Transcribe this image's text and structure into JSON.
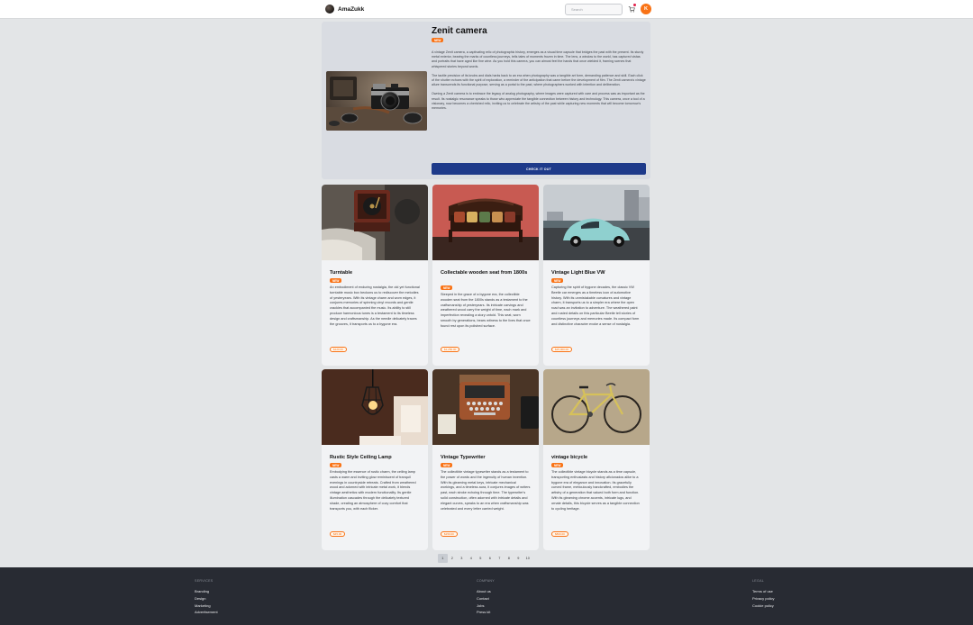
{
  "nav": {
    "brand": "AmaZukk",
    "search_placeholder": "Search",
    "avatar_initial": "K"
  },
  "hero": {
    "title": "Zenit camera",
    "badge": "NEW",
    "paragraphs": [
      "A vintage Zenit camera, a captivating relic of photographic history, emerges as a visual time capsule that bridges the past with the present. Its sturdy metal exterior, bearing the marks of countless journeys, tells tales of moments frozen in time. The lens, a window to the world, has captured vistas and portraits that have aged like fine wine. As you hold this camera, you can almost feel the hands that once wielded it, framing scenes that whispered stories beyond words.",
      "The tactile precision of its knobs and dials harks back to an era when photography was a tangible art form, demanding patience and skill. Each click of the shutter echoes with the spirit of exploration, a reminder of the anticipation that came before the development of film. The Zenit camera's vintage allure transcends its functional purpose, serving as a portal to the past, where photographers worked with intention and deliberation.",
      "Owning a Zenit camera is to embrace the legacy of analog photography, where images were captured with care and process was as important as the result. Its nostalgic resonance speaks to those who appreciate the tangible connection between history and technology. This camera, once a tool of a visionary, now becomes a cherished relic, inviting us to celebrate the artistry of the past while capturing new moments that will become tomorrow's memories."
    ],
    "cta": "CHECK IT OUT"
  },
  "products": [
    {
      "title": "Turntable",
      "badge": "NEW",
      "price": "$120.00",
      "description": "An embodiment of enduring nostalgia, the old yet functional turntable music box beckons us to rediscover the melodies of yesteryears. With its vintage charm and worn edges, it conjures memories of spinning vinyl records and gentle crackles that accompanied the music. Its ability to still produce harmonious tunes is a testament to its timeless design and craftsmanship. As the needle delicately traces the grooves, it transports us to a bygone era."
    },
    {
      "title": "Collectable wooden seat from 1800s",
      "badge": "NEW",
      "price": "$1,250.00",
      "description": "Steeped in the grace of a bygone era, the collectible wooden seat from the 1800s stands as a testament to the craftsmanship of yesteryears. Its intricate carvings and weathered wood carry the weight of time, each mark and imperfection revealing a story untold. This seat, worn smooth by generations, bears witness to the lives that once found rest upon its polished surface."
    },
    {
      "title": "Vintage Light Blue VW",
      "badge": "NEW",
      "price": "$15,000.00",
      "description": "Capturing the spirit of bygone decades, the classic VW Beetle car emerges as a timeless icon of automotive history. With its unmistakable curvatures and vintage charm, it transports us to a simpler era where the open road was an invitation to adventure. The weathered paint and rusted details on this particular Beetle tell stories of countless journeys and memories made. Its compact form and distinctive character evoke a sense of nostalgia."
    },
    {
      "title": "Rustic Style Ceiling Lamp",
      "badge": "NEW",
      "price": "$45.00",
      "description": "Embodying the essence of rustic charm, the ceiling lamp casts a warm and inviting glow reminiscent of tranquil evenings in countryside retreats. Crafted from weathered wood and adorned with intricate metal work, it blends vintage aesthetics with modern functionality. Its gentle illumination cascades through the delicately textured shade, creating an atmosphere of cozy comfort that transports you, with each flicker."
    },
    {
      "title": "Vintage Typewriter",
      "badge": "NEW",
      "price": "$150.00",
      "description": "The collectible vintage typewriter stands as a testament to the power of words and the ingenuity of human invention. With its gleaming metal keys, intricate mechanical workings, and a timeless aura, it conjures images of writers past, each stroke echoing through time. The typewriter's solid construction, often adorned with intricate details and elegant curves, speaks to an era when craftsmanship was celebrated and every letter carried weight."
    },
    {
      "title": "vintage bicycle",
      "badge": "NEW",
      "price": "$800.00",
      "description": "The collectible vintage bicycle stands as a time capsule, transporting enthusiasts and history aficionados alike to a bygone era of elegance and innovation. Its gracefully curved frame, meticulously handcrafted, embodies the artistry of a generation that valued both form and function. With its gleaming chrome accents, intricate lugs, and ornate details, this bicycle serves as a tangible connection to cycling heritage."
    }
  ],
  "pagination": [
    "1",
    "2",
    "3",
    "4",
    "5",
    "6",
    "7",
    "8",
    "9",
    "10"
  ],
  "footer": {
    "services": {
      "heading": "SERVICES",
      "links": [
        "Branding",
        "Design",
        "Marketing",
        "Advertisement"
      ]
    },
    "company": {
      "heading": "COMPANY",
      "links": [
        "About us",
        "Contact",
        "Jobs",
        "Press kit"
      ]
    },
    "legal": {
      "heading": "LEGAL",
      "links": [
        "Terms of use",
        "Privacy policy",
        "Cookie policy"
      ]
    }
  },
  "colors": {
    "accent": "#f97316",
    "cta": "#1e3a8a",
    "footer_bg": "#282b33",
    "page_bg": "#e3e5e7"
  }
}
